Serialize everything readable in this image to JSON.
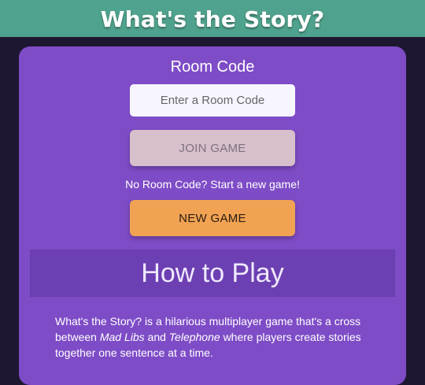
{
  "app": {
    "title": "What's the Story?"
  },
  "join": {
    "room_code_label": "Room Code",
    "room_code_placeholder": "Enter a Room Code",
    "join_button_label": "JOIN GAME",
    "no_room_text": "No Room Code? Start a new game!",
    "new_game_button_label": "NEW GAME"
  },
  "how_to_play": {
    "title": "How to Play",
    "description": {
      "part1": "What's the Story? is a hilarious multiplayer game that's a cross between ",
      "mad_libs": "Mad Libs",
      "and_text": " and ",
      "telephone": "Telephone",
      "part2": " where players create stories together one sentence at a time."
    }
  },
  "colors": {
    "background": "#1e1731",
    "header": "#4fa28d",
    "panel": "#7e4cc6",
    "how_to_play_band": "#6c40b2",
    "join_button": "#d7bfcb",
    "new_game_button": "#f1a353"
  }
}
